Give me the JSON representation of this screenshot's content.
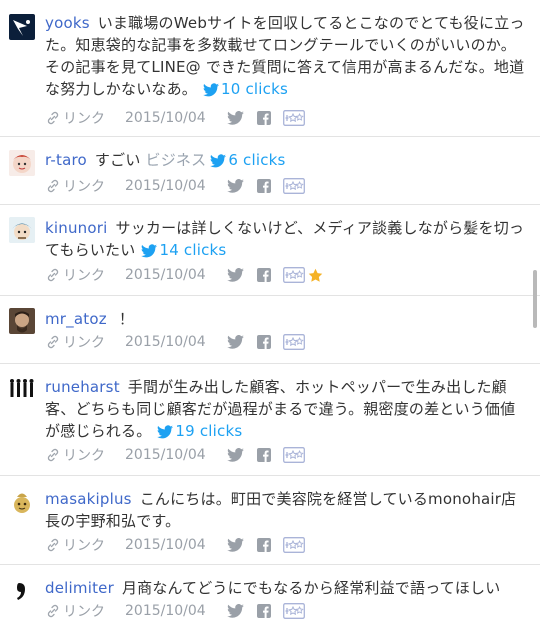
{
  "comments": [
    {
      "user": "yooks",
      "text": "いま職場のWebサイトを回収してるとこなのでとても役に立った。知恵袋的な記事を多数載せてロングテールでいくのがいいのか。その記事を見てLINE@ できた質問に答えて信用が高まるんだな。地道な努力しかないなあ。",
      "tag": "",
      "clicks": "10 clicks",
      "link": "リンク",
      "date": "2015/10/04",
      "starred": false
    },
    {
      "user": "r-taro",
      "text": "すごい",
      "tag": "ビジネス",
      "clicks": "6 clicks",
      "link": "リンク",
      "date": "2015/10/04",
      "starred": false
    },
    {
      "user": "kinunori",
      "text": "サッカーは詳しくないけど、メディア談義しながら髪を切ってもらいたい",
      "tag": "",
      "clicks": "14 clicks",
      "link": "リンク",
      "date": "2015/10/04",
      "starred": true
    },
    {
      "user": "mr_atoz",
      "text": "！",
      "tag": "",
      "clicks": "",
      "link": "リンク",
      "date": "2015/10/04",
      "starred": false
    },
    {
      "user": "runeharst",
      "text": "手間が生み出した顧客、ホットペッパーで生み出した顧客、どちらも同じ顧客だが過程がまるで違う。親密度の差という価値が感じられる。",
      "tag": "",
      "clicks": "19 clicks",
      "link": "リンク",
      "date": "2015/10/04",
      "starred": false
    },
    {
      "user": "masakiplus",
      "text": "こんにちは。町田で美容院を経営しているmonohair店長の宇野和弘です。",
      "tag": "",
      "clicks": "",
      "link": "リンク",
      "date": "2015/10/04",
      "starred": false
    },
    {
      "user": "delimiter",
      "text": "月商なんてどうにでもなるから経常利益で語ってほしい",
      "tag": "",
      "clicks": "",
      "link": "リンク",
      "date": "2015/10/04",
      "starred": false
    }
  ],
  "colors": {
    "username": "#3f68c9",
    "clicks": "#1da1f2",
    "meta": "#9aa0a8",
    "star": "#f5b225"
  },
  "icons": [
    "link-icon",
    "twitter-icon",
    "facebook-icon",
    "hatena-bookmark-icon",
    "star-icon"
  ]
}
